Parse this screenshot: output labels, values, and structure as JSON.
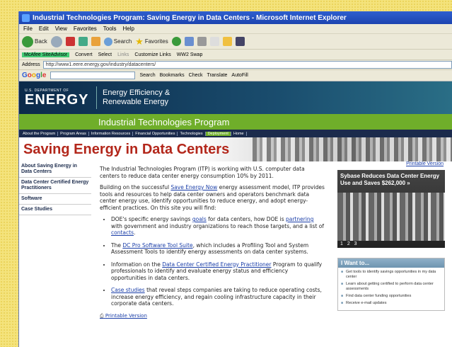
{
  "window": {
    "title": "Industrial Technologies Program: Saving Energy in Data Centers - Microsoft Internet Explorer"
  },
  "menu": [
    "File",
    "Edit",
    "View",
    "Favorites",
    "Tools",
    "Help"
  ],
  "toolbar": {
    "back": "Back",
    "search": "Search",
    "favorites": "Favorites"
  },
  "links_bar": {
    "mcafee": "McAfee SiteAdvisor",
    "convert": "Convert",
    "select": "Select",
    "links": "Links",
    "customize": "Customize Links",
    "wwz": "WW2 Swap"
  },
  "address": {
    "label": "Address",
    "url": "http://www1.eere.energy.gov/industry/datacenters/"
  },
  "google_bar": {
    "logo": "Google",
    "search": "Search",
    "bookmarks": "Bookmarks",
    "check": "Check",
    "translate": "Translate",
    "autofill": "AutoFill"
  },
  "header": {
    "dept_small": "U.S. DEPARTMENT OF",
    "energy": "ENERGY",
    "eere_line1": "Energy Efficiency &",
    "eere_line2": "Renewable Energy",
    "program": "Industrial Technologies Program"
  },
  "nav": [
    {
      "label": "About the Program",
      "active": false
    },
    {
      "label": "Program Areas",
      "active": false
    },
    {
      "label": "Information Resources",
      "active": false
    },
    {
      "label": "Financial Opportunities",
      "active": false
    },
    {
      "label": "Technologies",
      "active": false
    },
    {
      "label": "Deployment",
      "active": true
    },
    {
      "label": "Home",
      "active": false
    }
  ],
  "hero": {
    "title": "Saving Energy in Data Centers"
  },
  "leftnav": [
    "About Saving Energy in Data Centers",
    "Data Center Certified Energy Practitioners",
    "Software",
    "Case Studies"
  ],
  "main": {
    "intro": "The Industrial Technologies Program (ITP) is working with U.S. computer data centers to reduce data center energy consumption 10% by 2011.",
    "p2_a": "Building on the successful ",
    "p2_link": "Save Energy Now",
    "p2_b": " energy assessment model, ITP provides tools and resources to help data center owners and operators benchmark data center energy use, identify opportunities to reduce energy, and adopt energy-efficient practices. On this site you will find:",
    "b1_a": "DOE's specific energy savings ",
    "b1_link1": "goals",
    "b1_b": " for data centers, how DOE is ",
    "b1_link2": "partnering",
    "b1_c": " with government and industry organizations to reach those targets, and a list of ",
    "b1_link3": "contacts",
    "b1_d": ".",
    "b2_a": "The ",
    "b2_link": "DC Pro Software Tool Suite",
    "b2_b": ", which includes a Profiling Tool and System Assessment Tools to identify energy assessments on data center systems.",
    "b3_a": "Information on the ",
    "b3_link": "Data Center Certified Energy Practitioner",
    "b3_b": " Program to qualify professionals to identify and evaluate energy status and efficiency opportunities in data centers.",
    "b4_link": "Case studies",
    "b4_b": " that reveal steps companies are taking to reduce operating costs, increase energy efficiency, and regain cooling infrastructure capacity in their corporate data centers.",
    "print": "Printable Version"
  },
  "right": {
    "print": "Printable Version",
    "feature_title": "Sybase Reduces Data Center Energy Use and Saves $262,000 »",
    "feature_dots": "1 2 3",
    "iwant_head": "I Want to...",
    "iwant_items": [
      "Get tools to identify savings opportunities in my data center",
      "Learn about getting certified to perform data center assessments",
      "Find data center funding opportunities",
      "Receive e-mail updates"
    ]
  }
}
